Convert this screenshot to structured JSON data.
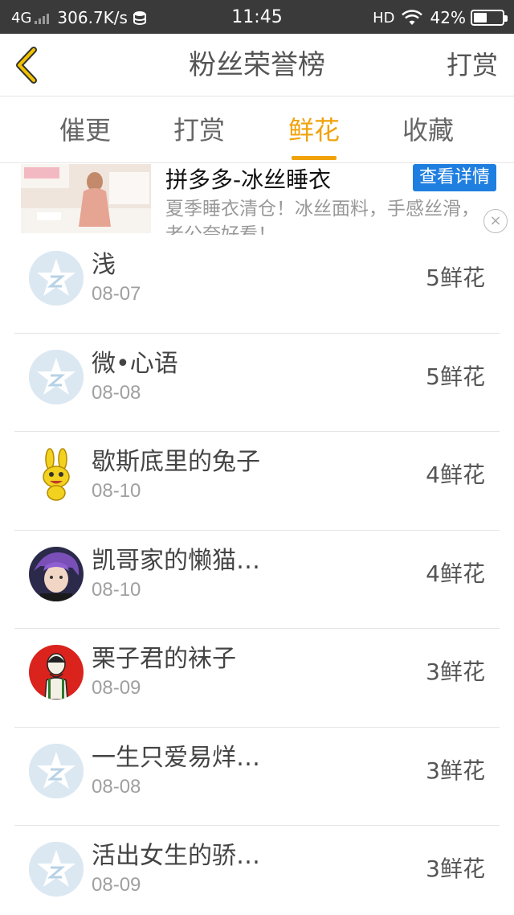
{
  "status_bar": {
    "network": "4G",
    "speed": "306.7K/s",
    "time": "11:45",
    "hd": "HD",
    "battery": "42%"
  },
  "nav": {
    "title": "粉丝荣誉榜",
    "right_action": "打赏"
  },
  "tabs": [
    {
      "label": "催更",
      "active": false
    },
    {
      "label": "打赏",
      "active": false
    },
    {
      "label": "鲜花",
      "active": true
    },
    {
      "label": "收藏",
      "active": false
    }
  ],
  "ad": {
    "title": "拼多多-冰丝睡衣",
    "description": "夏季睡衣清仓！冰丝面料，手感丝滑，老公夸好看！",
    "button": "查看详情",
    "close": "×"
  },
  "list": [
    {
      "name": "浅",
      "date": "08-07",
      "count": "5鲜花",
      "avatar": "default-avatar"
    },
    {
      "name": "微•心语",
      "date": "08-08",
      "count": "5鲜花",
      "avatar": "default-avatar"
    },
    {
      "name": "歇斯底里的兔子",
      "date": "08-10",
      "count": "4鲜花",
      "avatar": "rabbit-avatar"
    },
    {
      "name": "凯哥家的懒猫…",
      "date": "08-10",
      "count": "4鲜花",
      "avatar": "photo-avatar"
    },
    {
      "name": "栗子君的袜子",
      "date": "08-09",
      "count": "3鲜花",
      "avatar": "drawing-avatar"
    },
    {
      "name": "一生只爱易烊…",
      "date": "08-08",
      "count": "3鲜花",
      "avatar": "default-avatar"
    },
    {
      "name": "活出女生的骄…",
      "date": "08-09",
      "count": "3鲜花",
      "avatar": "default-avatar"
    }
  ],
  "colors": {
    "accent": "#f0a20a",
    "ad_button": "#1f7fe0",
    "status_bar": "#3a3a3a"
  }
}
